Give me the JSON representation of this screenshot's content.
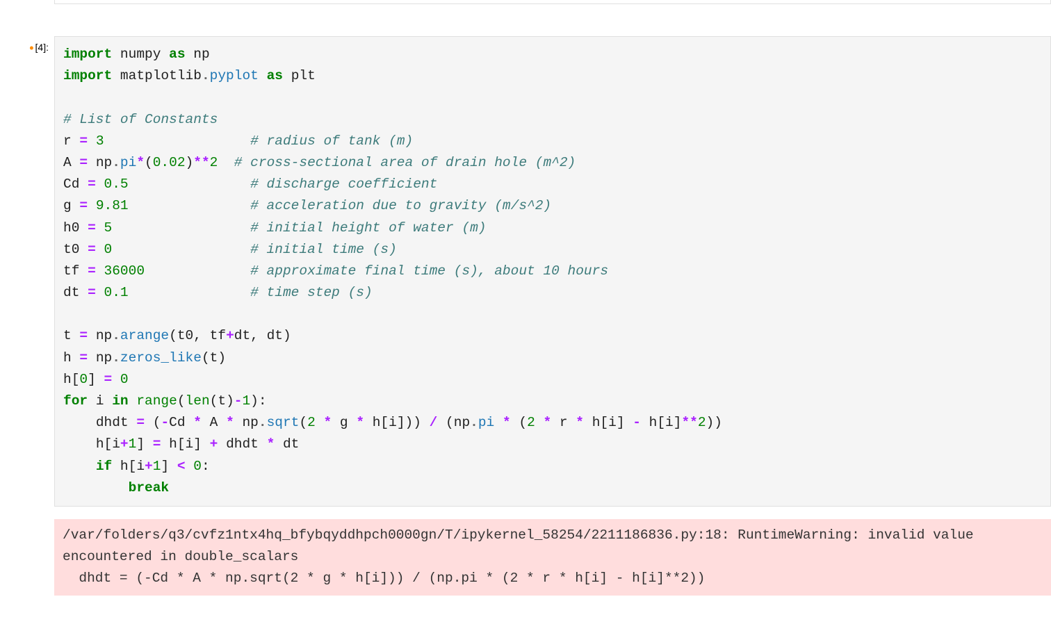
{
  "cell": {
    "prompt_number": "[4]:",
    "modified_indicator": "•",
    "code_lines": {
      "l1": {
        "import": "import",
        "numpy": "numpy",
        "as": "as",
        "np": "np"
      },
      "l2": {
        "import": "import",
        "matplotlib": "matplotlib",
        "dot": ".",
        "pyplot": "pyplot",
        "as": "as",
        "plt": "plt"
      },
      "l4": {
        "comment": "# List of Constants"
      },
      "l5": {
        "var": "r",
        "eq": " = ",
        "val": "3",
        "pad": "                  ",
        "comment": "# radius of tank (m)"
      },
      "l6": {
        "var": "A",
        "eq": " = ",
        "np": "np",
        "dot": ".",
        "pi": "pi",
        "star": "*",
        "lp": "(",
        "val1": "0.02",
        "rp": ")",
        "dstar": "**",
        "val2": "2",
        "pad": "  ",
        "comment": "# cross-sectional area of drain hole (m^2)"
      },
      "l7": {
        "var": "Cd",
        "eq": " = ",
        "val": "0.5",
        "pad": "               ",
        "comment": "# discharge coefficient"
      },
      "l8": {
        "var": "g",
        "eq": " = ",
        "val": "9.81",
        "pad": "               ",
        "comment": "# acceleration due to gravity (m/s^2)"
      },
      "l9": {
        "var": "h0",
        "eq": " = ",
        "val": "5",
        "pad": "                 ",
        "comment": "# initial height of water (m)"
      },
      "l10": {
        "var": "t0",
        "eq": " = ",
        "val": "0",
        "pad": "                 ",
        "comment": "# initial time (s)"
      },
      "l11": {
        "var": "tf",
        "eq": " = ",
        "val": "36000",
        "pad": "             ",
        "comment": "# approximate final time (s), about 10 hours"
      },
      "l12": {
        "var": "dt",
        "eq": " = ",
        "val": "0.1",
        "pad": "               ",
        "comment": "# time step (s)"
      },
      "l14": {
        "var": "t",
        "eq": " = ",
        "np": "np",
        "dot": ".",
        "arange": "arange",
        "lp": "(",
        "t0": "t0",
        "c1": ", ",
        "tf": "tf",
        "plus": "+",
        "dt": "dt",
        "c2": ", ",
        "dt2": "dt",
        "rp": ")"
      },
      "l15": {
        "var": "h",
        "eq": " = ",
        "np": "np",
        "dot": ".",
        "zeros": "zeros_like",
        "lp": "(",
        "t": "t",
        "rp": ")"
      },
      "l16": {
        "h": "h",
        "lb": "[",
        "zero": "0",
        "rb": "]",
        "eq": " = ",
        "val": "0"
      },
      "l17": {
        "for": "for",
        "i": " i ",
        "in": "in",
        "range": " range",
        "lp": "(",
        "len": "len",
        "lp2": "(",
        "t": "t",
        "rp2": ")",
        "minus": "-",
        "one": "1",
        "rp": ")",
        "colon": ":"
      },
      "l18": {
        "indent": "    ",
        "dhdt": "dhdt",
        "eq": " = ",
        "lp": "(",
        "minus": "-",
        "cd": "Cd",
        "s1": " ",
        "star1": "*",
        "s2": " ",
        "a": "A",
        "s3": " ",
        "star2": "*",
        "s4": " ",
        "np": "np",
        "dot": ".",
        "sqrt": "sqrt",
        "lp2": "(",
        "two": "2",
        "s5": " ",
        "star3": "*",
        "s6": " ",
        "g": "g",
        "s7": " ",
        "star4": "*",
        "s8": " ",
        "h": "h",
        "lb": "[",
        "i": "i",
        "rb": "]",
        "rp2": ")",
        "rp3": ")",
        "s9": " ",
        "div": "/",
        "s10": " ",
        "lp4": "(",
        "np2": "np",
        "dot2": ".",
        "pi": "pi",
        "s11": " ",
        "star5": "*",
        "s12": " ",
        "lp5": "(",
        "two2": "2",
        "s13": " ",
        "star6": "*",
        "s14": " ",
        "r": "r",
        "s15": " ",
        "star7": "*",
        "s16": " ",
        "h2": "h",
        "lb2": "[",
        "i2": "i",
        "rb2": "]",
        "s17": " ",
        "minus2": "-",
        "s18": " ",
        "h3": "h",
        "lb3": "[",
        "i3": "i",
        "rb3": "]",
        "dstar": "**",
        "two3": "2",
        "rp5": ")",
        "rp6": ")"
      },
      "l19": {
        "indent": "    ",
        "h": "h",
        "lb": "[",
        "i": "i",
        "plus": "+",
        "one": "1",
        "rb": "]",
        "eq": " = ",
        "h2": "h",
        "lb2": "[",
        "i2": "i",
        "rb2": "]",
        "s1": " ",
        "plus2": "+",
        "s2": " ",
        "dhdt": "dhdt",
        "s3": " ",
        "star": "*",
        "s4": " ",
        "dt": "dt"
      },
      "l20": {
        "indent": "    ",
        "if": "if",
        "s1": " ",
        "h": "h",
        "lb": "[",
        "i": "i",
        "plus": "+",
        "one": "1",
        "rb": "]",
        "s2": " ",
        "lt": "<",
        "s3": " ",
        "zero": "0",
        "colon": ":"
      },
      "l21": {
        "indent": "        ",
        "break": "break"
      }
    }
  },
  "error": {
    "text": "/var/folders/q3/cvfz1ntx4hq_bfybqyddhpch0000gn/T/ipykernel_58254/2211186836.py:18: RuntimeWarning: invalid value encountered in double_scalars\n  dhdt = (-Cd * A * np.sqrt(2 * g * h[i])) / (np.pi * (2 * r * h[i] - h[i]**2))"
  }
}
